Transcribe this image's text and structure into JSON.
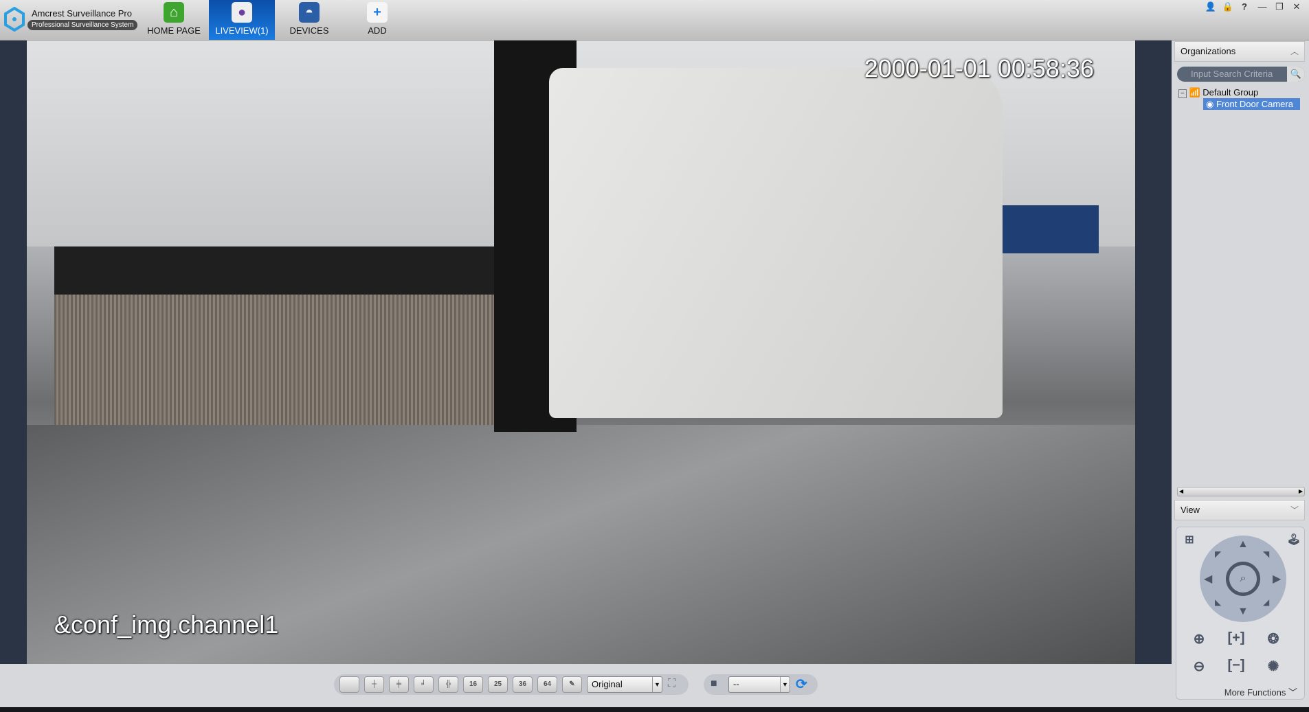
{
  "app": {
    "title": "Amcrest Surveillance Pro",
    "subtitle": "Professional Surveillance System"
  },
  "nav": [
    {
      "label": "HOME PAGE",
      "icon": "home-icon"
    },
    {
      "label": "LIVEVIEW(1)",
      "icon": "camera-lens-icon",
      "active": true
    },
    {
      "label": "DEVICES",
      "icon": "dome-camera-icon"
    },
    {
      "label": "ADD",
      "icon": "plus-icon"
    }
  ],
  "window_controls": [
    "user-icon",
    "lock-icon",
    "help-icon",
    "minimize-icon",
    "restore-icon",
    "close-icon"
  ],
  "video": {
    "timestamp": "2000-01-01 00:58:36",
    "channel_label": "&conf_img.channel1"
  },
  "panel": {
    "organizations": "Organizations",
    "search_placeholder": "Input Search Criteria",
    "tree": {
      "group": "Default Group",
      "camera": "Front Door Camera"
    },
    "view": "View",
    "more_functions": "More Functions"
  },
  "toolbar": {
    "layouts": [
      "1",
      "4",
      "6",
      "8",
      "9",
      "16",
      "25",
      "36",
      "64",
      "custom"
    ],
    "ratio": "Original",
    "stream": "--"
  },
  "colors": {
    "accent": "#1a7be0",
    "selection": "#4f86d6"
  }
}
